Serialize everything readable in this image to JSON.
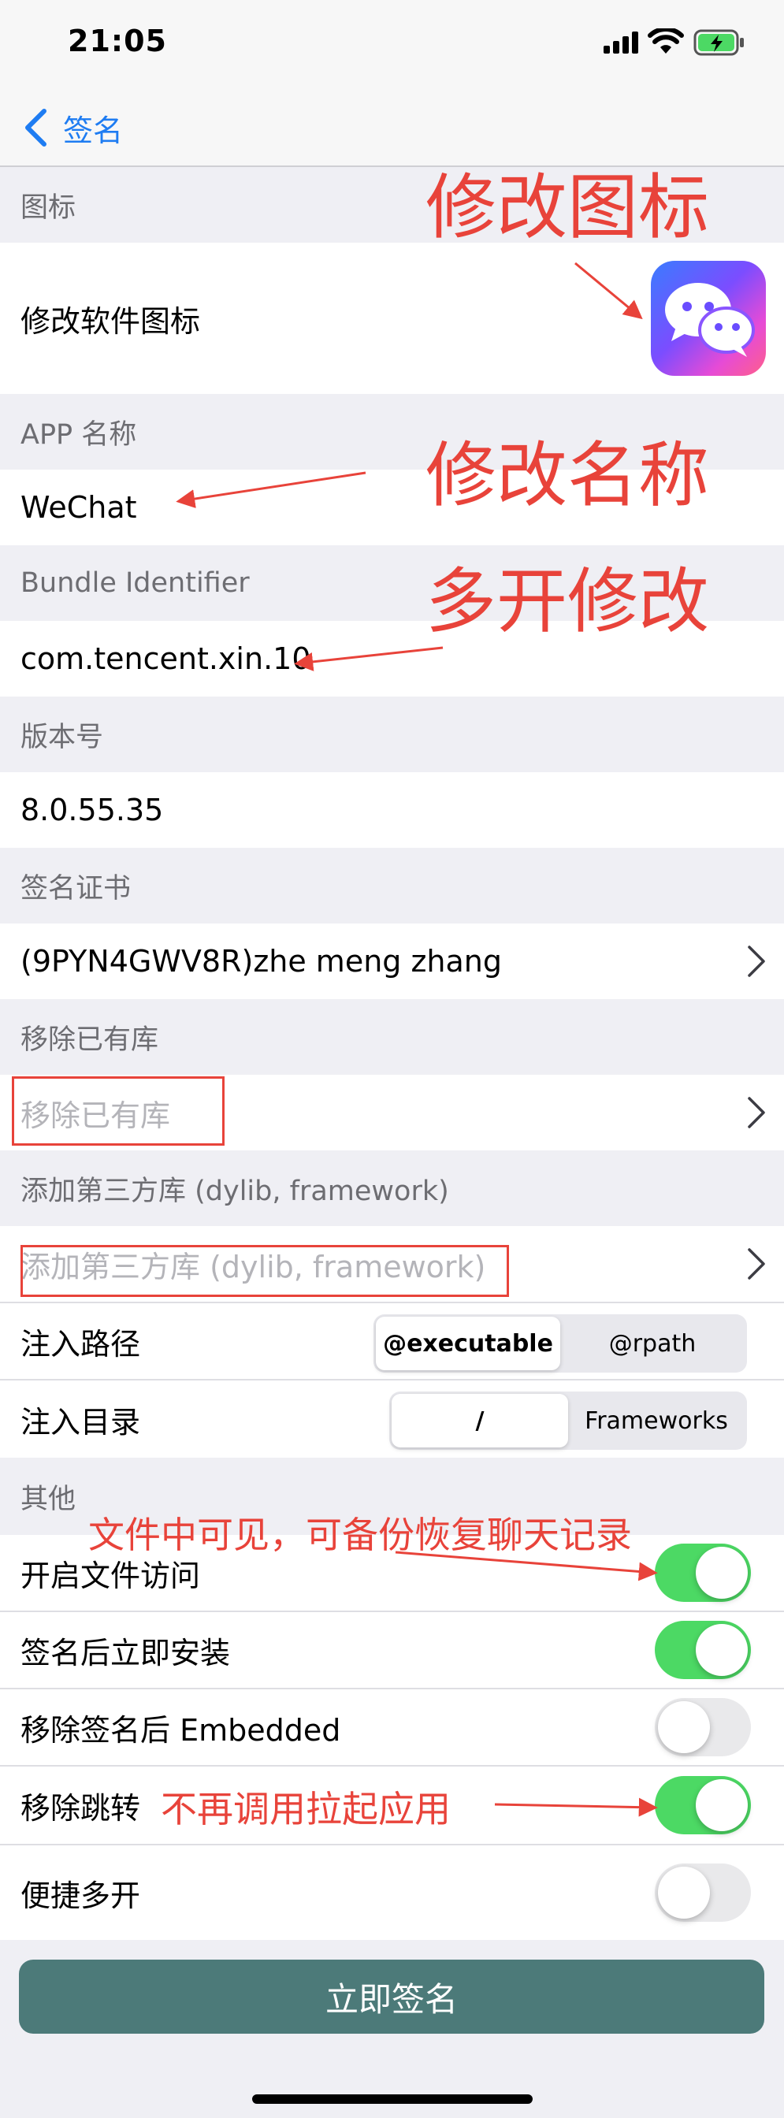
{
  "status_bar": {
    "time": "21:05"
  },
  "nav": {
    "back_label": "签名"
  },
  "sections": {
    "icon": "图标",
    "app_name": "APP 名称",
    "bundle": "Bundle Identifier",
    "version": "版本号",
    "cert": "签名证书",
    "remove_libs": "移除已有库",
    "add_libs": "添加第三方库 (dylib, framework)",
    "other": "其他"
  },
  "rows": {
    "change_icon": "修改软件图标",
    "app_name_value": "WeChat",
    "bundle_value": "com.tencent.xin.10",
    "version_value": "8.0.55.35",
    "cert_value": "(9PYN4GWV8R)zhe meng zhang",
    "remove_libs_placeholder": "移除已有库",
    "add_libs_placeholder": "添加第三方库 (dylib, framework)",
    "inject_path": "注入路径",
    "inject_dir": "注入目录"
  },
  "inject_path_segments": {
    "options": [
      "@executable",
      "@rpath"
    ],
    "selected": "@executable"
  },
  "inject_dir_segments": {
    "options": [
      "/",
      "Frameworks"
    ],
    "selected": "/"
  },
  "toggles": [
    {
      "label": "开启文件访问",
      "on": true
    },
    {
      "label": "签名后立即安装",
      "on": true
    },
    {
      "label": "移除签名后 Embedded",
      "on": false
    },
    {
      "label": "移除跳转",
      "on": true
    },
    {
      "label": "便捷多开",
      "on": false
    }
  ],
  "sign_button": "立即签名",
  "annotations": {
    "modify_icon": "修改图标",
    "modify_name": "修改名称",
    "multi_open": "多开修改",
    "file_access_note": "文件中可见，可备份恢复聊天记录",
    "no_jump_note": "不再调用拉起应用"
  },
  "colors": {
    "accent": "#1e7cf2",
    "toggle_on": "#4cd964",
    "annotation": "#e8433a",
    "sign_button": "#4c7a79"
  }
}
